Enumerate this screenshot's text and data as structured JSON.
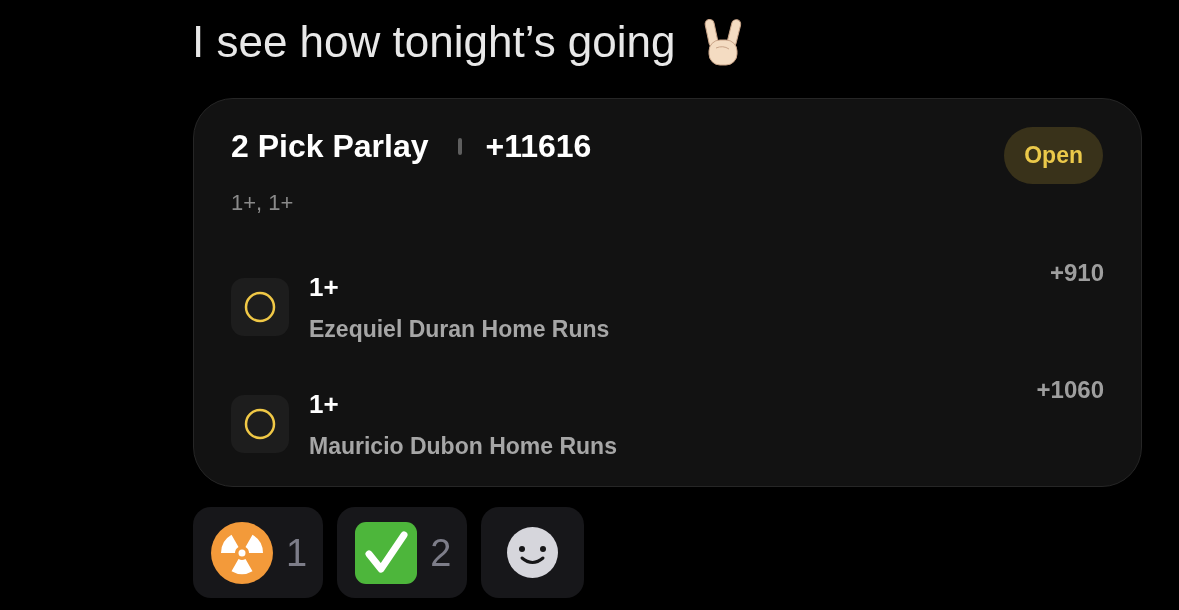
{
  "message": {
    "text": "I see how tonight’s going"
  },
  "card": {
    "title": "2 Pick Parlay",
    "odds": "+11616",
    "status": "Open",
    "summary": "1+, 1+",
    "legs": [
      {
        "kind": "pending",
        "line": "1+",
        "market": "Ezequiel Duran Home Runs",
        "odds": "+910"
      },
      {
        "kind": "pending",
        "line": "1+",
        "market": "Mauricio Dubon Home Runs",
        "odds": "+1060"
      }
    ]
  },
  "reactions": [
    {
      "kind": "radioactive",
      "count": "1"
    },
    {
      "kind": "check",
      "count": "2"
    },
    {
      "kind": "add"
    }
  ]
}
